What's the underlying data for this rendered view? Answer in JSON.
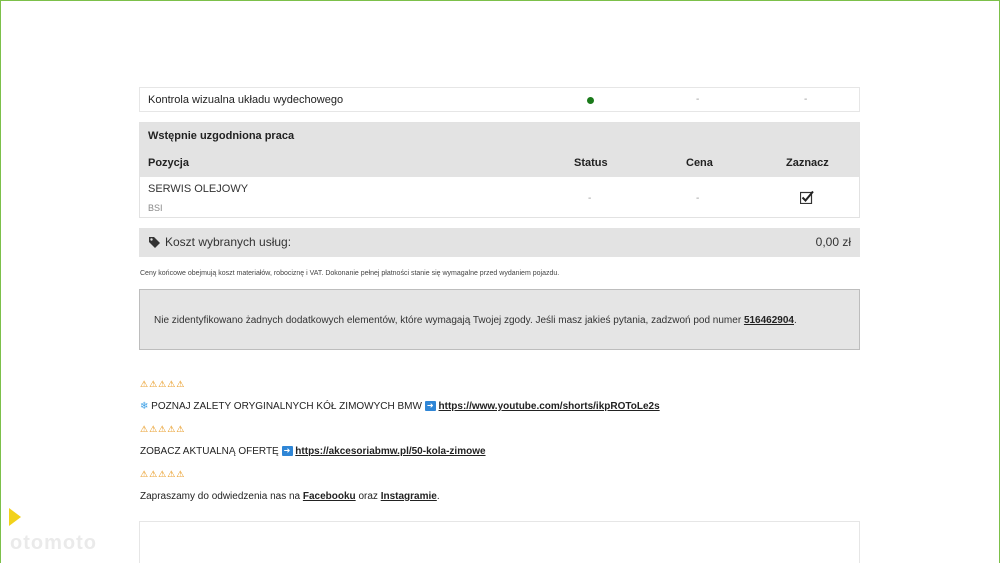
{
  "row1": {
    "name": "Kontrola wizualna układu wydechowego",
    "price": "-",
    "mark": "-"
  },
  "table": {
    "title": "Wstępnie uzgodniona praca",
    "columns": {
      "position": "Pozycja",
      "status": "Status",
      "price": "Cena",
      "mark": "Zaznacz"
    },
    "item": {
      "name": "SERWIS OLEJOWY",
      "sub": "BSI",
      "status": "-",
      "price": "-"
    }
  },
  "cost": {
    "label": "Koszt wybranych usług:",
    "value": "0,00 zł"
  },
  "note": "Ceny końcowe obejmują koszt materiałów, robociznę i VAT. Dokonanie pełnej płatności stanie się wymagalne przed wydaniem pojazdu.",
  "info": {
    "text": "Nie zidentyfikowano żadnych dodatkowych elementów, które wymagają Twojej zgody. Jeśli masz jakieś pytania, zadzwoń pod numer ",
    "phone": "516462904",
    "end": "."
  },
  "promo": {
    "warnings": "⚠⚠⚠⚠⚠",
    "line1_text": "POZNAJ ZALETY ORYGINALNYCH KÓŁ ZIMOWYCH BMW",
    "line1_link": "https://www.youtube.com/shorts/ikpROToLe2s",
    "line2_text": "ZOBACZ AKTUALNĄ OFERTĘ",
    "line2_link": "https://akcesoriabmw.pl/50-kola-zimowe",
    "line3_a": "Zapraszamy do odwiedzenia nas na ",
    "line3_fb": "Facebooku",
    "line3_b": " oraz ",
    "line3_ig": "Instagramie",
    "line3_c": "."
  },
  "watermark": "otomoto",
  "icons": {
    "status_dot": "green-dot",
    "checkbox": "checkbox-checked-icon",
    "tag": "tag-icon",
    "snowflake": "snowflake-icon",
    "arrow": "arrow-right-icon"
  },
  "colors": {
    "frame": "#7cc04a",
    "status_ok": "#1a7a1a",
    "panel": "#e3e3e3"
  }
}
